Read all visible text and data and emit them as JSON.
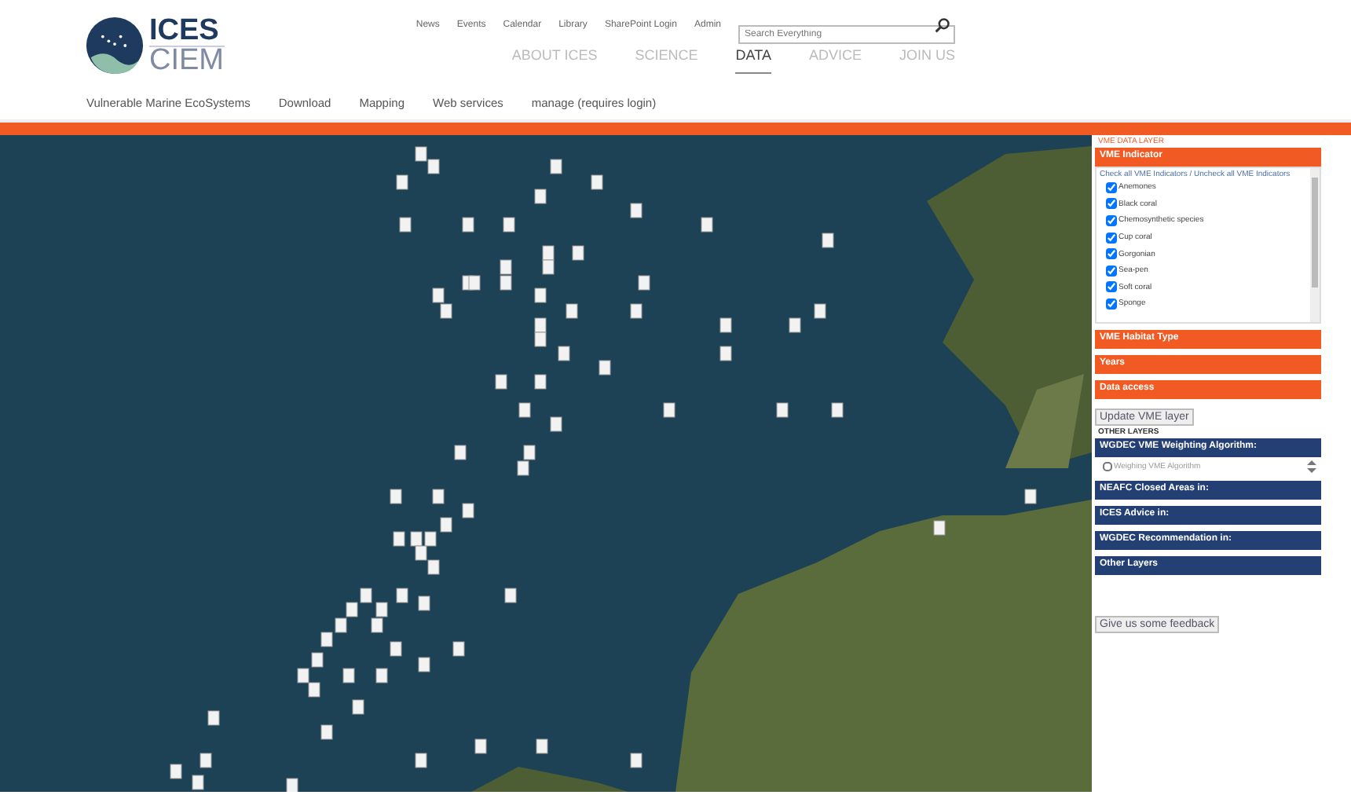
{
  "logo": {
    "line_1": "ICES",
    "line_2": "CIEM"
  },
  "utility_links": [
    "News",
    "Events",
    "Calendar",
    "Library",
    "SharePoint Login",
    "Admin"
  ],
  "search": {
    "placeholder": "Search Everything"
  },
  "main_nav": [
    {
      "label": "ABOUT ICES",
      "selected": false
    },
    {
      "label": "SCIENCE",
      "selected": false
    },
    {
      "label": "DATA",
      "selected": true
    },
    {
      "label": "ADVICE",
      "selected": false
    },
    {
      "label": "JOIN US",
      "selected": false
    }
  ],
  "sub_nav": [
    "Vulnerable Marine EcoSystems",
    "Download",
    "Mapping",
    "Web services",
    "manage (requires login)"
  ],
  "sidebar": {
    "section_title": "VME DATA LAYER",
    "indicator_header": "VME Indicator",
    "check_all_text": "Check all VME Indicators / Uncheck all VME Indicators",
    "indicators": [
      {
        "label": "Anemones",
        "checked": true
      },
      {
        "label": "Black coral",
        "checked": true
      },
      {
        "label": "Chemosynthetic species",
        "checked": true
      },
      {
        "label": "Cup coral",
        "checked": true
      },
      {
        "label": "Gorgonian",
        "checked": true
      },
      {
        "label": "Sea-pen",
        "checked": true
      },
      {
        "label": "Soft coral",
        "checked": true
      },
      {
        "label": "Sponge",
        "checked": true
      }
    ],
    "orange_panels": [
      "VME Habitat Type",
      "Years",
      "Data access"
    ],
    "update_button": "Update VME layer",
    "other_title": "OTHER LAYERS",
    "weighting_header": "WGDEC VME Weighting Algorithm:",
    "weighting_option": {
      "label": "Weighing VME Algorithm",
      "checked": false
    },
    "blue_panels": [
      "NEAFC Closed Areas in:",
      "ICES Advice in:",
      "WGDEC Recommendation in:",
      "Other Layers"
    ],
    "feedback_button": "Give us some feedback"
  }
}
